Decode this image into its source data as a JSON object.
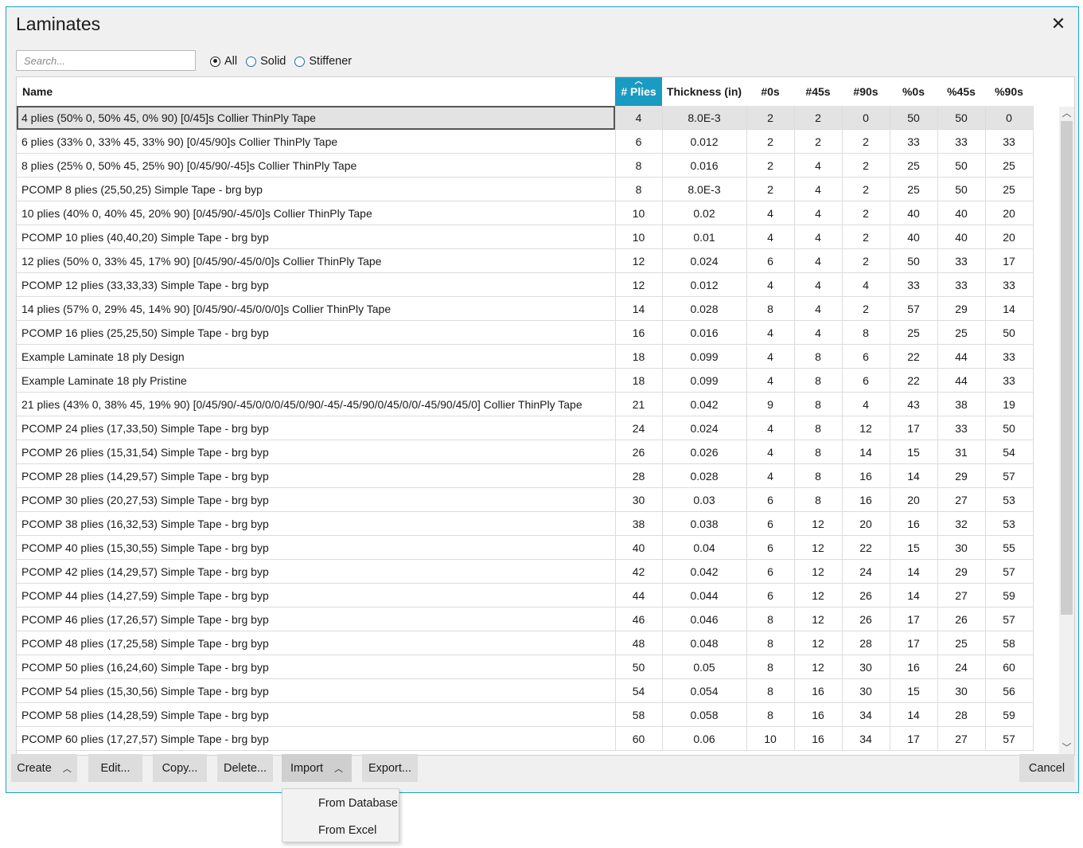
{
  "dialog": {
    "title": "Laminates",
    "close_glyph": "✕"
  },
  "search": {
    "placeholder": "Search..."
  },
  "filters": [
    {
      "label": "All",
      "selected": true
    },
    {
      "label": "Solid",
      "selected": false
    },
    {
      "label": "Stiffener",
      "selected": false
    }
  ],
  "table": {
    "columns": [
      "Name",
      "# Plies",
      "Thickness (in)",
      "#0s",
      "#45s",
      "#90s",
      "%0s",
      "%45s",
      "%90s"
    ],
    "sorted_column": "# Plies",
    "sort_direction": "ascending",
    "selected_row": 0,
    "rows": [
      [
        "4 plies (50% 0, 50% 45, 0% 90) [0/45]s Collier ThinPly Tape",
        "4",
        "8.0E-3",
        "2",
        "2",
        "0",
        "50",
        "50",
        "0"
      ],
      [
        "6 plies (33% 0, 33% 45, 33% 90) [0/45/90]s Collier ThinPly Tape",
        "6",
        "0.012",
        "2",
        "2",
        "2",
        "33",
        "33",
        "33"
      ],
      [
        "8 plies (25% 0, 50% 45, 25% 90) [0/45/90/-45]s Collier ThinPly Tape",
        "8",
        "0.016",
        "2",
        "4",
        "2",
        "25",
        "50",
        "25"
      ],
      [
        "PCOMP 8 plies (25,50,25) Simple Tape - brg byp",
        "8",
        "8.0E-3",
        "2",
        "4",
        "2",
        "25",
        "50",
        "25"
      ],
      [
        "10 plies (40% 0, 40% 45, 20% 90) [0/45/90/-45/0]s Collier ThinPly Tape",
        "10",
        "0.02",
        "4",
        "4",
        "2",
        "40",
        "40",
        "20"
      ],
      [
        "PCOMP 10 plies (40,40,20) Simple Tape - brg byp",
        "10",
        "0.01",
        "4",
        "4",
        "2",
        "40",
        "40",
        "20"
      ],
      [
        "12 plies (50% 0, 33% 45, 17% 90) [0/45/90/-45/0/0]s Collier ThinPly Tape",
        "12",
        "0.024",
        "6",
        "4",
        "2",
        "50",
        "33",
        "17"
      ],
      [
        "PCOMP 12 plies (33,33,33) Simple Tape - brg byp",
        "12",
        "0.012",
        "4",
        "4",
        "4",
        "33",
        "33",
        "33"
      ],
      [
        "14 plies (57% 0, 29% 45, 14% 90) [0/45/90/-45/0/0/0]s Collier ThinPly Tape",
        "14",
        "0.028",
        "8",
        "4",
        "2",
        "57",
        "29",
        "14"
      ],
      [
        "PCOMP 16 plies (25,25,50) Simple Tape - brg byp",
        "16",
        "0.016",
        "4",
        "4",
        "8",
        "25",
        "25",
        "50"
      ],
      [
        "Example Laminate 18 ply Design",
        "18",
        "0.099",
        "4",
        "8",
        "6",
        "22",
        "44",
        "33"
      ],
      [
        "Example Laminate 18 ply Pristine",
        "18",
        "0.099",
        "4",
        "8",
        "6",
        "22",
        "44",
        "33"
      ],
      [
        "21 plies (43% 0, 38% 45, 19% 90) [0/45/90/-45/0/0/0/45/0/90/-45/-45/90/0/45/0/0/-45/90/45/0] Collier ThinPly Tape",
        "21",
        "0.042",
        "9",
        "8",
        "4",
        "43",
        "38",
        "19"
      ],
      [
        "PCOMP 24 plies (17,33,50) Simple Tape - brg byp",
        "24",
        "0.024",
        "4",
        "8",
        "12",
        "17",
        "33",
        "50"
      ],
      [
        "PCOMP 26 plies (15,31,54) Simple Tape - brg byp",
        "26",
        "0.026",
        "4",
        "8",
        "14",
        "15",
        "31",
        "54"
      ],
      [
        "PCOMP 28 plies (14,29,57) Simple Tape - brg byp",
        "28",
        "0.028",
        "4",
        "8",
        "16",
        "14",
        "29",
        "57"
      ],
      [
        "PCOMP 30 plies (20,27,53) Simple Tape - brg byp",
        "30",
        "0.03",
        "6",
        "8",
        "16",
        "20",
        "27",
        "53"
      ],
      [
        "PCOMP 38 plies (16,32,53) Simple Tape - brg byp",
        "38",
        "0.038",
        "6",
        "12",
        "20",
        "16",
        "32",
        "53"
      ],
      [
        "PCOMP 40 plies (15,30,55) Simple Tape - brg byp",
        "40",
        "0.04",
        "6",
        "12",
        "22",
        "15",
        "30",
        "55"
      ],
      [
        "PCOMP 42 plies (14,29,57) Simple Tape - brg byp",
        "42",
        "0.042",
        "6",
        "12",
        "24",
        "14",
        "29",
        "57"
      ],
      [
        "PCOMP 44 plies (14,27,59) Simple Tape - brg byp",
        "44",
        "0.044",
        "6",
        "12",
        "26",
        "14",
        "27",
        "59"
      ],
      [
        "PCOMP 46 plies (17,26,57) Simple Tape - brg byp",
        "46",
        "0.046",
        "8",
        "12",
        "26",
        "17",
        "26",
        "57"
      ],
      [
        "PCOMP 48 plies (17,25,58) Simple Tape - brg byp",
        "48",
        "0.048",
        "8",
        "12",
        "28",
        "17",
        "25",
        "58"
      ],
      [
        "PCOMP 50 plies (16,24,60) Simple Tape - brg byp",
        "50",
        "0.05",
        "8",
        "12",
        "30",
        "16",
        "24",
        "60"
      ],
      [
        "PCOMP 54 plies (15,30,56) Simple Tape - brg byp",
        "54",
        "0.054",
        "8",
        "16",
        "30",
        "15",
        "30",
        "56"
      ],
      [
        "PCOMP 58 plies (14,28,59) Simple Tape - brg byp",
        "58",
        "0.058",
        "8",
        "16",
        "34",
        "14",
        "28",
        "59"
      ],
      [
        "PCOMP 60 plies (17,27,57) Simple Tape - brg byp",
        "60",
        "0.06",
        "10",
        "16",
        "34",
        "17",
        "27",
        "57"
      ]
    ]
  },
  "buttons": {
    "create": "Create",
    "edit": "Edit...",
    "copy": "Copy...",
    "delete": "Delete...",
    "import": "Import",
    "export": "Export...",
    "cancel": "Cancel"
  },
  "import_menu": {
    "items": [
      "From Database",
      "From Excel"
    ]
  },
  "icons": {
    "sort": "sort-ascending-icon",
    "close": "close-icon",
    "scroll_up": "chevron-up-icon",
    "scroll_down": "chevron-down-icon"
  },
  "colors": {
    "accent": "#1a9bc2",
    "dialog_border": "#19a3c9",
    "selected_row": "#e3e3e3",
    "button": "#dddddd"
  }
}
